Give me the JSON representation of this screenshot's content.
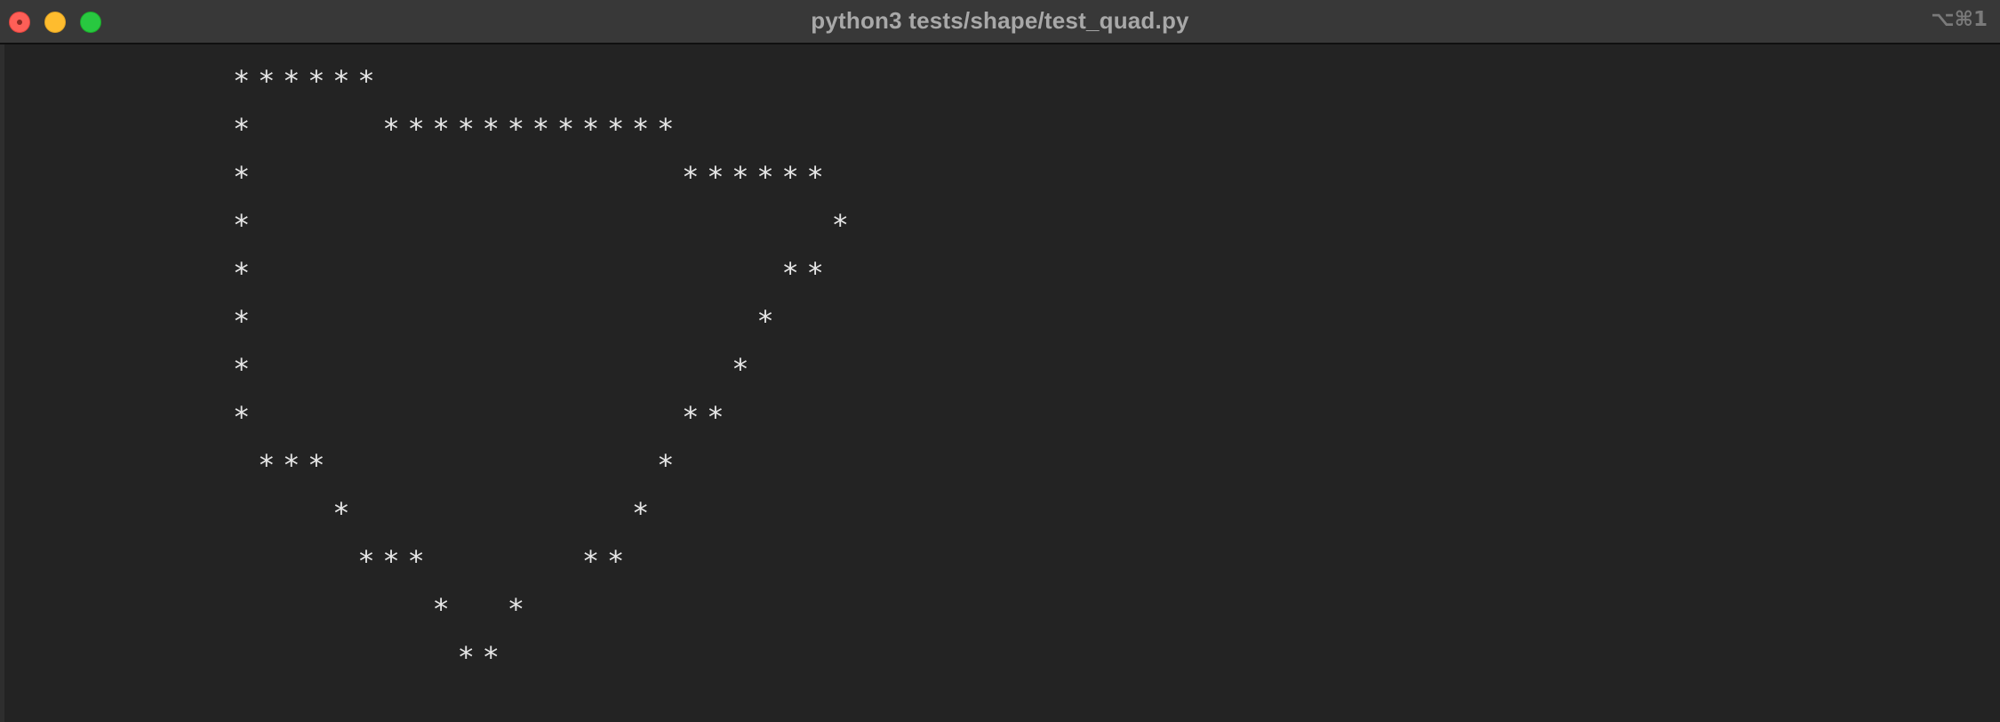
{
  "window": {
    "title": "python3 tests/shape/test_quad.py",
    "shortcut": "⌥⌘1"
  },
  "terminal": {
    "lines": [
      "******",
      "*     ************",
      "*                 ******",
      "*                       *",
      "*                     **",
      "*                    *",
      "*                   *",
      "*                 **",
      " ***             *",
      "    *           *",
      "     ***      **",
      "        *  *",
      "         **"
    ]
  },
  "colors": {
    "background": "#232323",
    "titlebar": "#383838",
    "text": "#e6e6e6",
    "close": "#fe5f57",
    "minimize": "#febc2e",
    "zoom": "#28c840"
  }
}
